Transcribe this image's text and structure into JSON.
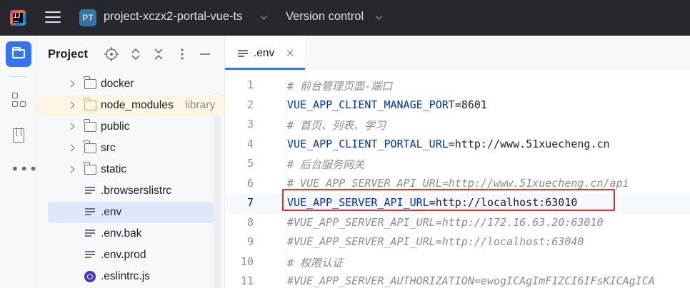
{
  "topbar": {
    "app_logo_icon": "jetbrains-ide-logo",
    "project_badge": "PT",
    "project_name": "project-xczx2-portal-vue-ts",
    "vcs_label": "Version control"
  },
  "toolstrip": {
    "items": [
      "folder-icon",
      "structure-icon",
      "bookmarks-icon",
      "more-icon"
    ]
  },
  "project_panel": {
    "title": "Project",
    "tree": [
      {
        "type": "folder",
        "label": "docker",
        "expandable": true
      },
      {
        "type": "folder",
        "label": "node_modules",
        "tag": "library",
        "expandable": true,
        "highlight": "library"
      },
      {
        "type": "folder",
        "label": "public",
        "expandable": true
      },
      {
        "type": "folder",
        "label": "src",
        "expandable": true
      },
      {
        "type": "folder",
        "label": "static",
        "expandable": true
      },
      {
        "type": "file",
        "label": ".browserslistrc"
      },
      {
        "type": "file",
        "label": ".env",
        "selected": true
      },
      {
        "type": "file",
        "label": ".env.bak"
      },
      {
        "type": "file",
        "label": ".env.prod"
      },
      {
        "type": "eslint",
        "label": ".eslintrc.js"
      }
    ]
  },
  "editor": {
    "tab": {
      "name": ".env",
      "close": "×"
    },
    "lines": [
      {
        "n": "1",
        "comment": true,
        "text": "# 前台管理页面-端口"
      },
      {
        "n": "2",
        "key": "VUE_APP_CLIENT_MANAGE_PORT",
        "value": "=8601"
      },
      {
        "n": "3",
        "comment": true,
        "text": "# 首页、列表、学习"
      },
      {
        "n": "4",
        "key": "VUE_APP_CLIENT_PORTAL_URL",
        "value": "=http://www.51xuecheng.cn"
      },
      {
        "n": "5",
        "comment": true,
        "text": "# 后台服务网关"
      },
      {
        "n": "6",
        "comment": true,
        "text": "# VUE_APP_SERVER_API_URL=http://www.51xuecheng.cn/api"
      },
      {
        "n": "7",
        "key": "VUE_APP_SERVER_API_URL",
        "value": "=http://localhost:63010",
        "current": true
      },
      {
        "n": "8",
        "comment": true,
        "text": "#VUE_APP_SERVER_API_URL=http://172.16.63.20:63010"
      },
      {
        "n": "9",
        "comment": true,
        "text": "#VUE_APP_SERVER_API_URL=http://localhost:63040"
      },
      {
        "n": "10",
        "comment": true,
        "text": "# 权限认证"
      },
      {
        "n": "11",
        "comment": true,
        "text": "#VUE_APP_SERVER_AUTHORIZATION=ewogICAgImF1ZCI6IFsKICAgICA"
      }
    ],
    "highlight_color": "#e03131"
  }
}
